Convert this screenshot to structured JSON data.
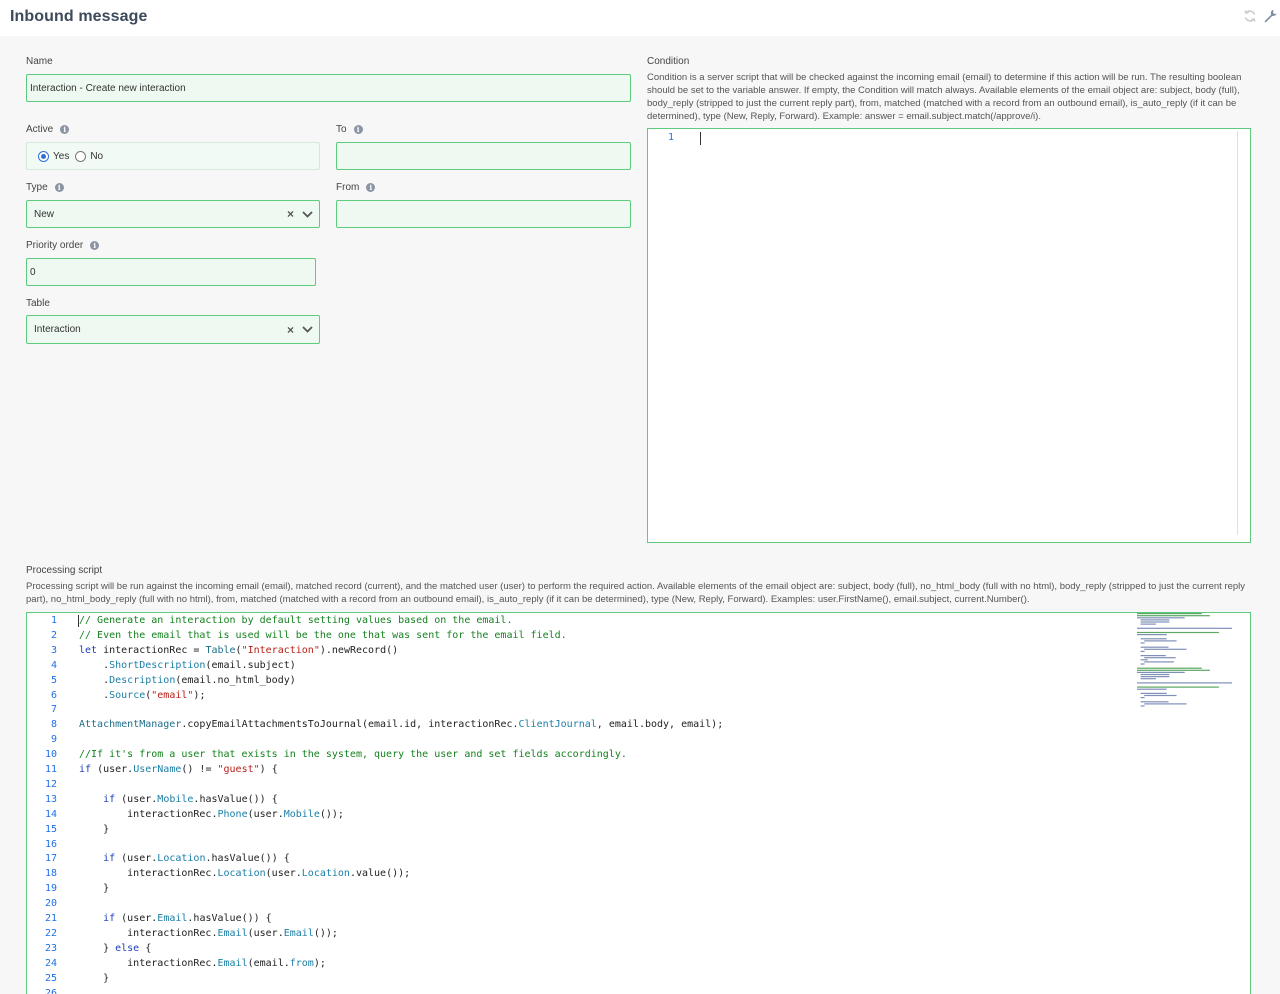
{
  "header": {
    "title": "Inbound message"
  },
  "form": {
    "name": {
      "label": "Name",
      "value": "Interaction - Create new interaction"
    },
    "active": {
      "label": "Active",
      "options": [
        "Yes",
        "No"
      ],
      "selected": "Yes"
    },
    "to": {
      "label": "To",
      "value": ""
    },
    "type": {
      "label": "Type",
      "value": "New"
    },
    "from": {
      "label": "From",
      "value": ""
    },
    "priority": {
      "label": "Priority order",
      "value": "0"
    },
    "table": {
      "label": "Table",
      "value": "Interaction"
    }
  },
  "condition": {
    "label": "Condition",
    "description": "Condition is a server script that will be checked against the incoming email (email) to determine if this action will be run. The resulting boolean should be set to the variable answer. If empty, the Condition will match always. Available elements of the email object are: subject, body (full), body_reply (stripped to just the current reply part), from, matched (matched with a record from an outbound email), is_auto_reply (if it can be determined), type (New, Reply, Forward). Example: answer = email.subject.match(/approve/i).",
    "line_number": "1"
  },
  "processing": {
    "label": "Processing script",
    "description": "Processing script will be run against the incoming email (email), matched record (current), and the matched user (user) to perform the required action. Available elements of the email object are: subject, body (full), no_html_body (full with no html), body_reply (stripped to just the current reply part), no_html_body_reply (full with no html), from, matched (matched with a record from an outbound email), is_auto_reply (if it can be determined), type (New, Reply, Forward). Examples: user.FirstName(), email.subject, current.Number().",
    "lines": [
      "// Generate an interaction by default setting values based on the email.",
      "// Even the email that is used will be the one that was sent for the email field.",
      "let interactionRec = Table(\"Interaction\").newRecord()",
      "    .ShortDescription(email.subject)",
      "    .Description(email.no_html_body)",
      "    .Source(\"email\");",
      "",
      "AttachmentManager.copyEmailAttachmentsToJournal(email.id, interactionRec.ClientJournal, email.body, email);",
      "",
      "//If it's from a user that exists in the system, query the user and set fields accordingly.",
      "if (user.UserName() != \"guest\") {",
      "",
      "    if (user.Mobile.hasValue()) {",
      "        interactionRec.Phone(user.Mobile());",
      "    }",
      "",
      "    if (user.Location.hasValue()) {",
      "        interactionRec.Location(user.Location.value());",
      "    }",
      "",
      "    if (user.Email.hasValue()) {",
      "        interactionRec.Email(user.Email());",
      "    } else {",
      "        interactionRec.Email(email.from);",
      "    }",
      ""
    ]
  },
  "colors": {
    "field_border": "#5ecb7f",
    "field_bg": "#eef9f1",
    "line_number": "#1f6feb",
    "comment": "#15821f",
    "keyword": "#1b3dbd",
    "string": "#b8211a"
  }
}
